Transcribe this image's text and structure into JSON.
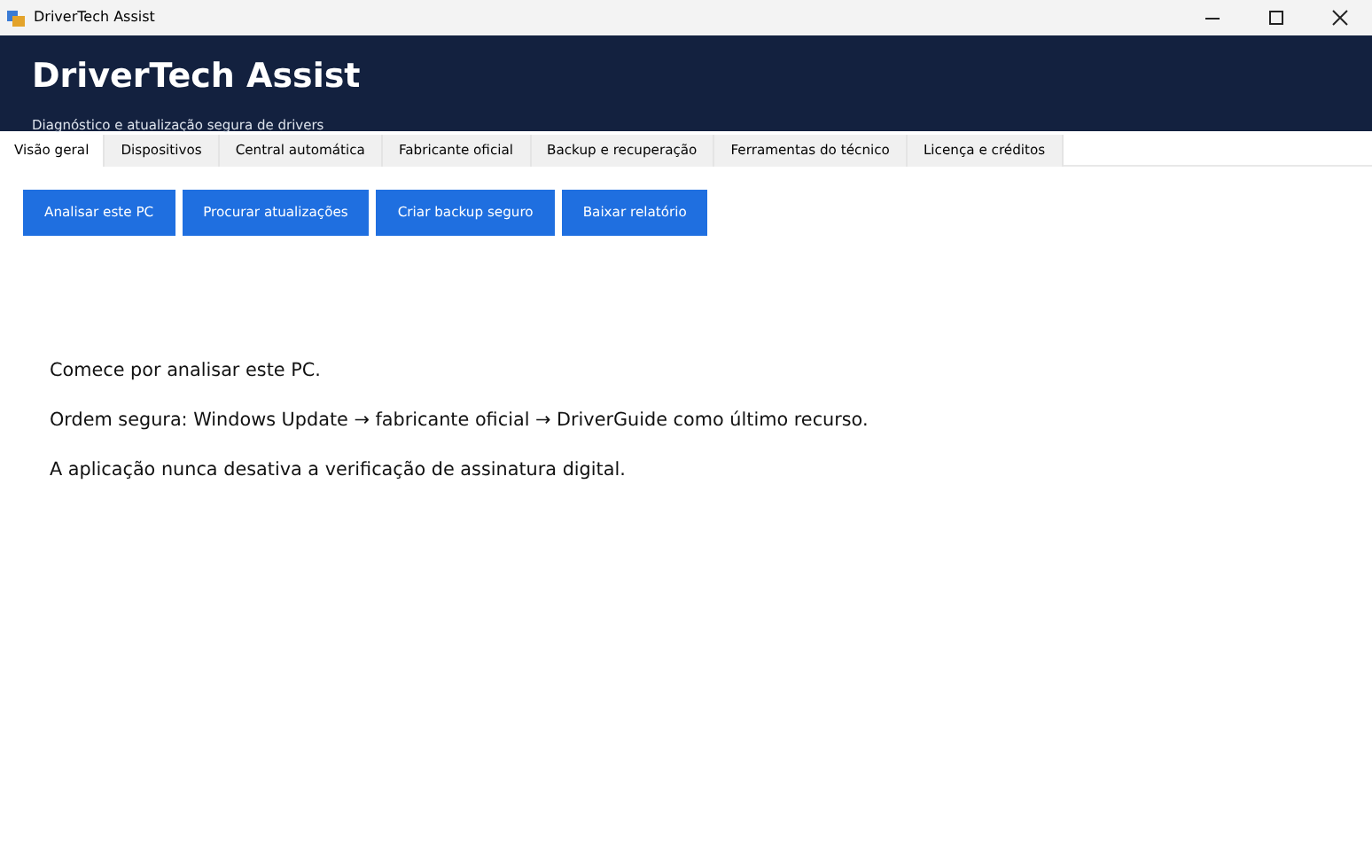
{
  "window": {
    "title": "DriverTech Assist"
  },
  "header": {
    "title": "DriverTech Assist",
    "subtitle": "Diagnóstico e atualização segura de drivers"
  },
  "tabs": [
    {
      "label": "Visão geral",
      "selected": true
    },
    {
      "label": "Dispositivos",
      "selected": false
    },
    {
      "label": "Central automática",
      "selected": false
    },
    {
      "label": "Fabricante oficial",
      "selected": false
    },
    {
      "label": "Backup e recuperação",
      "selected": false
    },
    {
      "label": "Ferramentas do técnico",
      "selected": false
    },
    {
      "label": "Licença e créditos",
      "selected": false
    }
  ],
  "buttons": [
    "Analisar este PC",
    "Procurar atualizações",
    "Criar backup seguro",
    "Baixar relatório"
  ],
  "messages": [
    "Comece por analisar este PC.",
    "Ordem segura: Windows Update → fabricante oficial → DriverGuide como último recurso.",
    "A aplicação nunca desativa a verificação de assinatura digital."
  ]
}
